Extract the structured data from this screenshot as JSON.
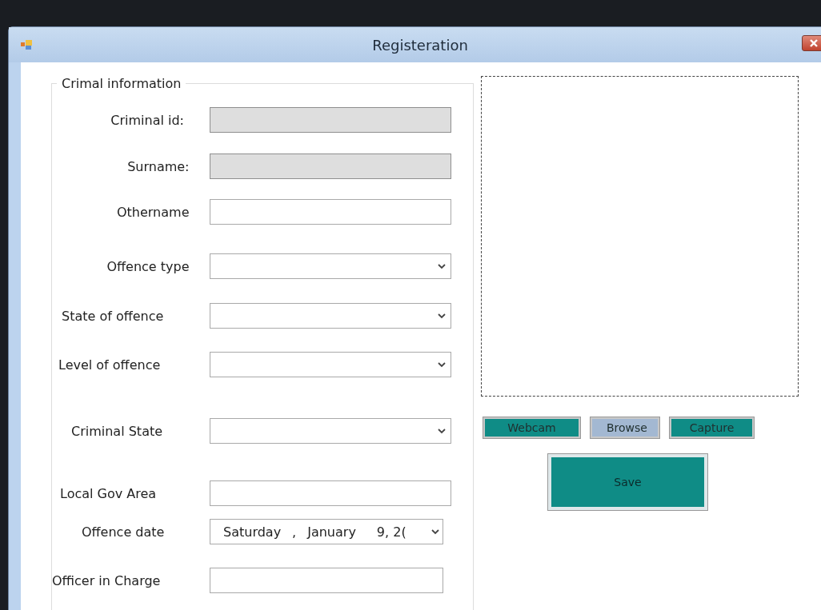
{
  "window": {
    "title": "Registeration"
  },
  "group": {
    "title": "Crimal information",
    "fields": [
      {
        "label": "Criminal id:",
        "kind": "text",
        "disabled": true
      },
      {
        "label": "Surname:",
        "kind": "text",
        "disabled": true
      },
      {
        "label": "Othername",
        "kind": "text",
        "disabled": false
      },
      {
        "label": "Offence type",
        "kind": "combo",
        "disabled": false
      },
      {
        "label": "State of offence",
        "kind": "combo",
        "disabled": false
      },
      {
        "label": "Level of offence",
        "kind": "combo",
        "disabled": false
      },
      {
        "label": "Criminal State",
        "kind": "combo",
        "disabled": false
      },
      {
        "label": "Local Gov Area",
        "kind": "text",
        "disabled": false
      },
      {
        "label": "Offence date",
        "kind": "date",
        "disabled": false,
        "parts": [
          "Saturday",
          ",",
          "January",
          "9, 2("
        ]
      },
      {
        "label": "Officer in Charge",
        "kind": "text",
        "disabled": false
      }
    ]
  },
  "photo_buttons": [
    {
      "label": "Webcam",
      "color": "#0f8c86"
    },
    {
      "label": "Browse",
      "color": "#a3b8d2"
    },
    {
      "label": "Capture",
      "color": "#0f8c86"
    }
  ],
  "save_button": {
    "label": "Save"
  }
}
